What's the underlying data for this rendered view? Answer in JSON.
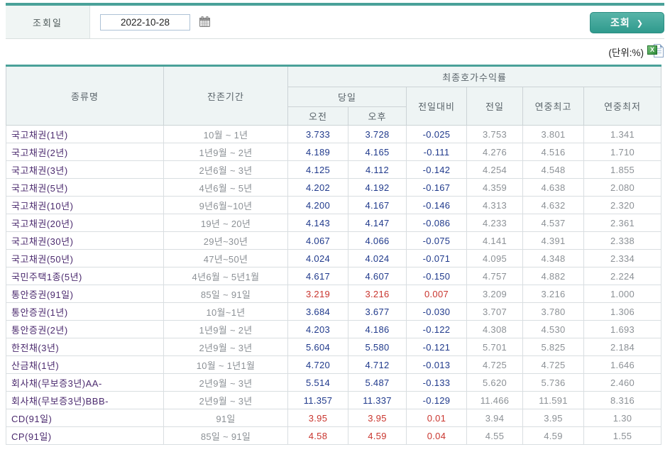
{
  "toolbar": {
    "date_label": "조회일",
    "date_value": "2022-10-28",
    "search_button": "조회",
    "search_arrow": "❯"
  },
  "meta": {
    "unit_label": "(단위:%)",
    "excel_icon_glyph": "X"
  },
  "colors": {
    "accent_teal": "#4aa199",
    "button_teal": "#35a093",
    "header_bg": "#eef4f4",
    "type_text": "#4b2a6e",
    "value_down": "#203a8c",
    "value_up": "#c9352e",
    "reference_gray": "#8c9196"
  },
  "table": {
    "headers": {
      "type": "종류명",
      "maturity": "잔존기간",
      "yield_group": "최종호가수익률",
      "today": "당일",
      "am": "오전",
      "pm": "오후",
      "vs_prev": "전일대비",
      "prev": "전일",
      "year_high": "연중최고",
      "year_low": "연중최저"
    },
    "rows": [
      {
        "type": "국고채권(1년)",
        "maturity": "10월 ~ 1년",
        "am": "3.733",
        "pm": "3.728",
        "change": "-0.025",
        "prev": "3.753",
        "high": "3.801",
        "low": "1.341",
        "trend": "down"
      },
      {
        "type": "국고채권(2년)",
        "maturity": "1년9월 ~ 2년",
        "am": "4.189",
        "pm": "4.165",
        "change": "-0.111",
        "prev": "4.276",
        "high": "4.516",
        "low": "1.710",
        "trend": "down"
      },
      {
        "type": "국고채권(3년)",
        "maturity": "2년6월 ~ 3년",
        "am": "4.125",
        "pm": "4.112",
        "change": "-0.142",
        "prev": "4.254",
        "high": "4.548",
        "low": "1.855",
        "trend": "down"
      },
      {
        "type": "국고채권(5년)",
        "maturity": "4년6월 ~ 5년",
        "am": "4.202",
        "pm": "4.192",
        "change": "-0.167",
        "prev": "4.359",
        "high": "4.638",
        "low": "2.080",
        "trend": "down"
      },
      {
        "type": "국고채권(10년)",
        "maturity": "9년6월~10년",
        "am": "4.200",
        "pm": "4.167",
        "change": "-0.146",
        "prev": "4.313",
        "high": "4.632",
        "low": "2.320",
        "trend": "down"
      },
      {
        "type": "국고채권(20년)",
        "maturity": "19년 ~ 20년",
        "am": "4.143",
        "pm": "4.147",
        "change": "-0.086",
        "prev": "4.233",
        "high": "4.537",
        "low": "2.361",
        "trend": "down"
      },
      {
        "type": "국고채권(30년)",
        "maturity": "29년~30년",
        "am": "4.067",
        "pm": "4.066",
        "change": "-0.075",
        "prev": "4.141",
        "high": "4.391",
        "low": "2.338",
        "trend": "down"
      },
      {
        "type": "국고채권(50년)",
        "maturity": "47년~50년",
        "am": "4.024",
        "pm": "4.024",
        "change": "-0.071",
        "prev": "4.095",
        "high": "4.348",
        "low": "2.334",
        "trend": "down"
      },
      {
        "type": "국민주택1종(5년)",
        "maturity": "4년6월 ~ 5년1월",
        "am": "4.617",
        "pm": "4.607",
        "change": "-0.150",
        "prev": "4.757",
        "high": "4.882",
        "low": "2.224",
        "trend": "down"
      },
      {
        "type": "통안증권(91일)",
        "maturity": "85일 ~ 91일",
        "am": "3.219",
        "pm": "3.216",
        "change": "0.007",
        "prev": "3.209",
        "high": "3.216",
        "low": "1.000",
        "trend": "up"
      },
      {
        "type": "통안증권(1년)",
        "maturity": "10월~1년",
        "am": "3.684",
        "pm": "3.677",
        "change": "-0.030",
        "prev": "3.707",
        "high": "3.780",
        "low": "1.306",
        "trend": "down"
      },
      {
        "type": "통안증권(2년)",
        "maturity": "1년9월 ~ 2년",
        "am": "4.203",
        "pm": "4.186",
        "change": "-0.122",
        "prev": "4.308",
        "high": "4.530",
        "low": "1.693",
        "trend": "down"
      },
      {
        "type": "한전채(3년)",
        "maturity": "2년9월 ~ 3년",
        "am": "5.604",
        "pm": "5.580",
        "change": "-0.121",
        "prev": "5.701",
        "high": "5.825",
        "low": "2.184",
        "trend": "down"
      },
      {
        "type": "산금채(1년)",
        "maturity": "10월 ~ 1년1월",
        "am": "4.720",
        "pm": "4.712",
        "change": "-0.013",
        "prev": "4.725",
        "high": "4.725",
        "low": "1.646",
        "trend": "down"
      },
      {
        "type": "회사채(무보증3년)AA-",
        "maturity": "2년9월 ~ 3년",
        "am": "5.514",
        "pm": "5.487",
        "change": "-0.133",
        "prev": "5.620",
        "high": "5.736",
        "low": "2.460",
        "trend": "down"
      },
      {
        "type": "회사채(무보증3년)BBB-",
        "maturity": "2년9월 ~ 3년",
        "am": "11.357",
        "pm": "11.337",
        "change": "-0.129",
        "prev": "11.466",
        "high": "11.591",
        "low": "8.316",
        "trend": "down"
      },
      {
        "type": "CD(91일)",
        "maturity": "91일",
        "am": "3.95",
        "pm": "3.95",
        "change": "0.01",
        "prev": "3.94",
        "high": "3.95",
        "low": "1.30",
        "trend": "up"
      },
      {
        "type": "CP(91일)",
        "maturity": "85일 ~ 91일",
        "am": "4.58",
        "pm": "4.59",
        "change": "0.04",
        "prev": "4.55",
        "high": "4.59",
        "low": "1.55",
        "trend": "up"
      }
    ]
  }
}
